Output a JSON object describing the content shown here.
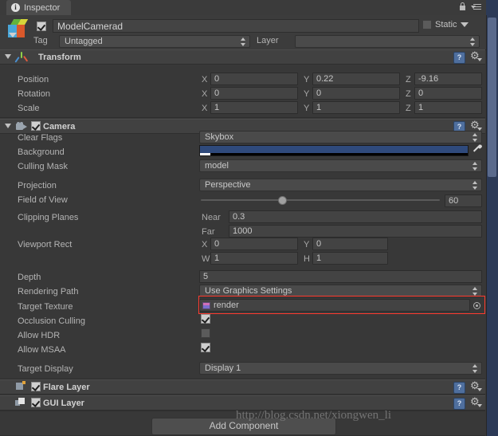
{
  "window": {
    "tab_label": "Inspector",
    "tab_icon": "info-icon",
    "lock_icon": "lock-icon",
    "menu_icon": "hamburger-menu-icon"
  },
  "object_header": {
    "icon": "gameobject-cube-icon",
    "enabled": true,
    "name": "ModelCamerad",
    "static_label": "Static",
    "static_checked": false,
    "tag_label": "Tag",
    "tag_value": "Untagged",
    "layer_label": "Layer",
    "layer_value": ""
  },
  "transform": {
    "title": "Transform",
    "icon": "transform-gizmo-icon",
    "help_icon": "?",
    "rows": [
      {
        "label": "Position",
        "x": "0",
        "y": "0.22",
        "z": "-9.16"
      },
      {
        "label": "Rotation",
        "x": "0",
        "y": "0",
        "z": "0"
      },
      {
        "label": "Scale",
        "x": "1",
        "y": "1",
        "z": "1"
      }
    ],
    "axis_x": "X",
    "axis_y": "Y",
    "axis_z": "Z"
  },
  "camera": {
    "title": "Camera",
    "icon": "camera-icon",
    "enabled": true,
    "help_icon": "?",
    "clear_flags": {
      "label": "Clear Flags",
      "value": "Skybox"
    },
    "background": {
      "label": "Background",
      "color": "#2f4a7c",
      "eyedropper_icon": "eyedropper-icon"
    },
    "culling_mask": {
      "label": "Culling Mask",
      "value": "model"
    },
    "projection": {
      "label": "Projection",
      "value": "Perspective"
    },
    "field_of_view": {
      "label": "Field of View",
      "value": "60",
      "slider_pct": 34
    },
    "clipping_planes": {
      "label": "Clipping Planes",
      "near_label": "Near",
      "near": "0.3",
      "far_label": "Far",
      "far": "1000"
    },
    "viewport_rect": {
      "label": "Viewport Rect",
      "x_label": "X",
      "x": "0",
      "y_label": "Y",
      "y": "0",
      "w_label": "W",
      "w": "1",
      "h_label": "H",
      "h": "1"
    },
    "depth": {
      "label": "Depth",
      "value": "5"
    },
    "rendering_path": {
      "label": "Rendering Path",
      "value": "Use Graphics Settings"
    },
    "target_texture": {
      "label": "Target Texture",
      "value": "render",
      "asset_icon": "render-texture-icon",
      "picker_icon": "object-picker-icon",
      "highlighted": true,
      "highlight_color": "#ff3b30"
    },
    "occlusion_culling": {
      "label": "Occlusion Culling",
      "checked": true
    },
    "allow_hdr": {
      "label": "Allow HDR",
      "checked": false
    },
    "allow_msaa": {
      "label": "Allow MSAA",
      "checked": true
    },
    "target_display": {
      "label": "Target Display",
      "value": "Display 1"
    }
  },
  "components": [
    {
      "title": "Flare Layer",
      "icon": "flare-layer-icon",
      "enabled": true,
      "help_icon": "?"
    },
    {
      "title": "GUI Layer",
      "icon": "gui-layer-icon",
      "enabled": true,
      "help_icon": "?"
    }
  ],
  "footer": {
    "add_component_label": "Add Component",
    "watermark": "http://blog.csdn.net/xiongwen_li"
  }
}
